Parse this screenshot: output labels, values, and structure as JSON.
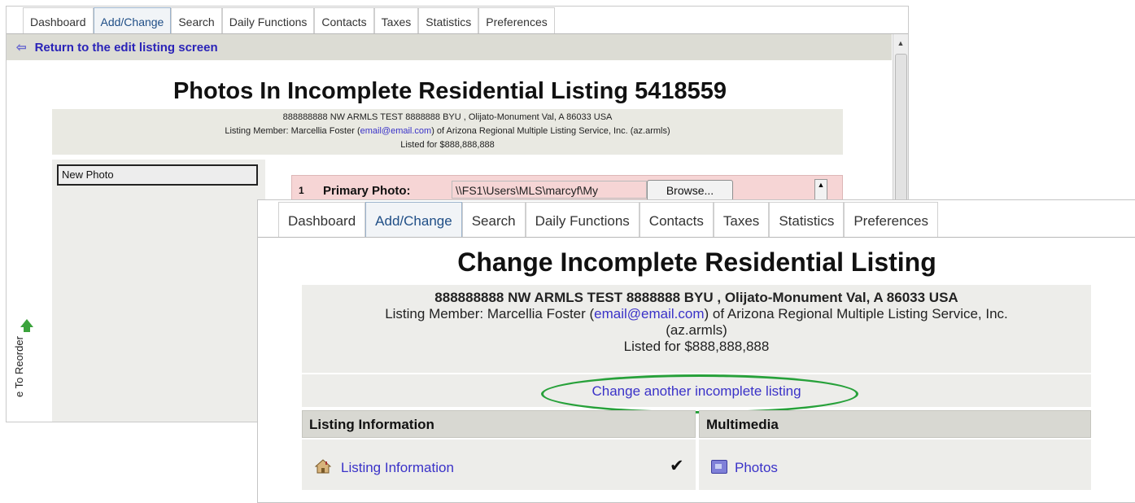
{
  "back_window": {
    "tabs": [
      "Dashboard",
      "Add/Change",
      "Search",
      "Daily Functions",
      "Contacts",
      "Taxes",
      "Statistics",
      "Preferences"
    ],
    "active_tab": "Add/Change",
    "return_link": "Return to the edit listing screen",
    "title": "Photos In Incomplete Residential Listing 5418559",
    "address": "888888888 NW ARMLS TEST 8888888 BYU , Olijato-Monument Val, A 86033 USA",
    "member_prefix": "Listing Member: Marcellia Foster (",
    "member_email": "email@email.com",
    "member_suffix": ") of Arizona Regional Multiple Listing Service, Inc. (az.armls)",
    "price": "Listed for $888,888,888",
    "new_photo_label": "New Photo",
    "reorder_text": "e To Reorder",
    "photo_row": {
      "number": "1",
      "label": "Primary Photo:",
      "path_value": "\\\\FS1\\Users\\MLS\\marcyf\\My",
      "browse": "Browse..."
    }
  },
  "front_window": {
    "tabs": [
      "Dashboard",
      "Add/Change",
      "Search",
      "Daily Functions",
      "Contacts",
      "Taxes",
      "Statistics",
      "Preferences"
    ],
    "active_tab": "Add/Change",
    "title": "Change Incomplete Residential Listing",
    "address": "888888888 NW ARMLS TEST 8888888 BYU , Olijato-Monument Val, A 86033 USA",
    "member_prefix": "Listing Member: Marcellia Foster (",
    "member_email": "email@email.com",
    "member_suffix": ") of Arizona Regional Multiple Listing Service, Inc.",
    "member_suffix2": "(az.armls)",
    "price": "Listed for $888,888,888",
    "change_another": "Change another incomplete listing",
    "col_left_header": "Listing Information",
    "col_right_header": "Multimedia",
    "listing_info_link": "Listing Information",
    "checkmark": "✔",
    "photos_link": "Photos"
  },
  "colors": {
    "link": "#3a32c8",
    "highlight_oval": "#27a13a",
    "photo_row_bg": "#f6d5d5"
  }
}
